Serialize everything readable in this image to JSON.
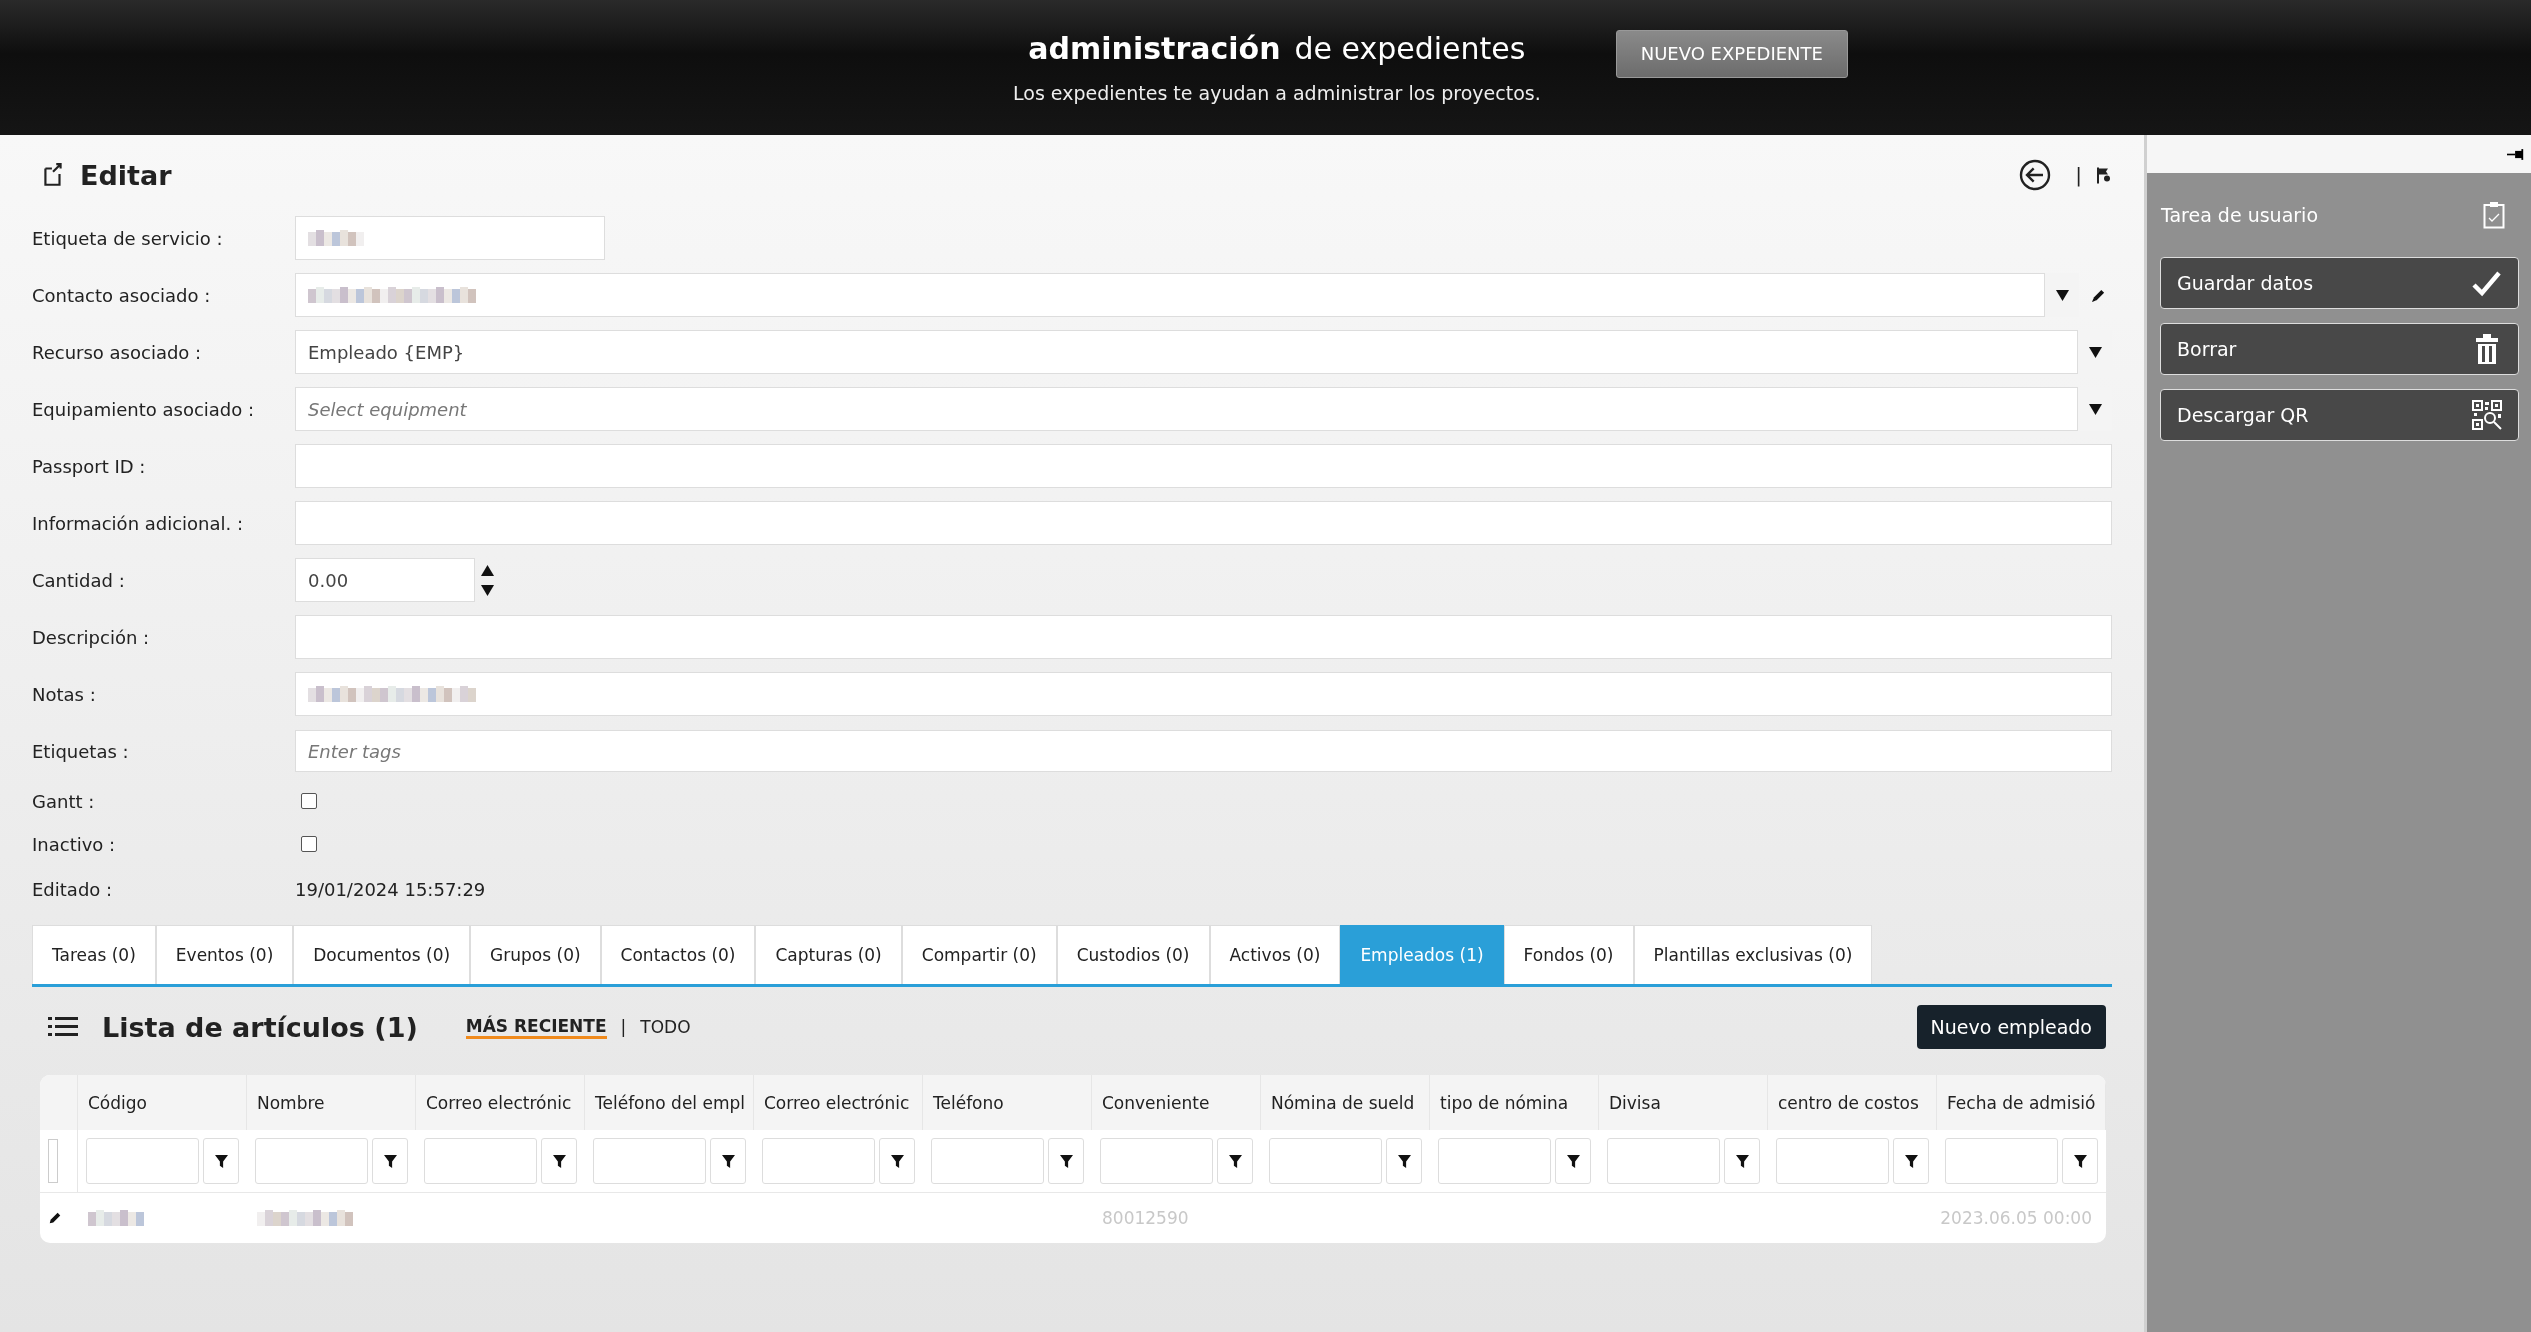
{
  "header": {
    "title_bold": "administración",
    "title_rest": "de expedientes",
    "subtitle": "Los expedientes te ayudan a administrar los proyectos.",
    "button": "NUEVO EXPEDIENTE"
  },
  "editor": {
    "title": "Editar",
    "toolbar_separator": "|",
    "fields": [
      {
        "label": "Etiqueta de servicio :",
        "kind": "short_text",
        "redacted": true
      },
      {
        "label": "Contacto asociado :",
        "kind": "select",
        "redacted": true,
        "edit_button": true
      },
      {
        "label": "Recurso asociado :",
        "kind": "select",
        "value": "Empleado {EMP}"
      },
      {
        "label": "Equipamiento asociado :",
        "kind": "select",
        "placeholder": "Select equipment"
      },
      {
        "label": "Passport ID :",
        "kind": "text"
      },
      {
        "label": "Información adicional. :",
        "kind": "text"
      },
      {
        "label": "Cantidad :",
        "kind": "number",
        "value": "0.00"
      },
      {
        "label": "Descripción :",
        "kind": "text"
      },
      {
        "label": "Notas :",
        "kind": "text",
        "redacted": true
      },
      {
        "label": "Etiquetas :",
        "kind": "tags",
        "placeholder": "Enter tags"
      },
      {
        "label": "Gantt :",
        "kind": "checkbox",
        "checked": false
      },
      {
        "label": "Inactivo :",
        "kind": "checkbox",
        "checked": false
      },
      {
        "label": "Editado :",
        "kind": "static",
        "value": "19/01/2024 15:57:29"
      }
    ]
  },
  "tabs": [
    {
      "label": "Tareas (0)",
      "selected": false
    },
    {
      "label": "Eventos (0)",
      "selected": false
    },
    {
      "label": "Documentos (0)",
      "selected": false
    },
    {
      "label": "Grupos (0)",
      "selected": false
    },
    {
      "label": "Contactos (0)",
      "selected": false
    },
    {
      "label": "Capturas (0)",
      "selected": false
    },
    {
      "label": "Compartir (0)",
      "selected": false
    },
    {
      "label": "Custodios (0)",
      "selected": false
    },
    {
      "label": "Activos (0)",
      "selected": false
    },
    {
      "label": "Empleados (1)",
      "selected": true
    },
    {
      "label": "Fondos (0)",
      "selected": false
    },
    {
      "label": "Plantillas exclusivas (0)",
      "selected": false
    }
  ],
  "list": {
    "title": "Lista de artículos (1)",
    "separator": "|",
    "filters": [
      {
        "label": "MÁS RECIENTE",
        "selected": true
      },
      {
        "label": "TODO",
        "selected": false
      }
    ],
    "button": "Nuevo empleado"
  },
  "table": {
    "columns": [
      "Código",
      "Nombre",
      "Correo electrónic",
      "Teléfono del empl",
      "Correo electrónic",
      "Teléfono",
      "Conveniente",
      "Nómina de sueld",
      "tipo de nómina",
      "Divisa",
      "centro de costos",
      "Fecha de admisió"
    ],
    "rows": [
      {
        "cells": [
          {
            "redacted": true
          },
          {
            "redacted": true
          },
          {},
          {},
          {},
          {},
          {
            "text": "80012590"
          },
          {},
          {},
          {},
          {},
          {
            "text": "2023.06.05 00:00"
          }
        ]
      }
    ]
  },
  "sidebar": {
    "title": "Tarea de usuario",
    "actions": [
      {
        "label": "Guardar datos",
        "kind": "save"
      },
      {
        "label": "Borrar",
        "kind": "delete"
      },
      {
        "label": "Descargar QR",
        "kind": "qr"
      }
    ]
  }
}
